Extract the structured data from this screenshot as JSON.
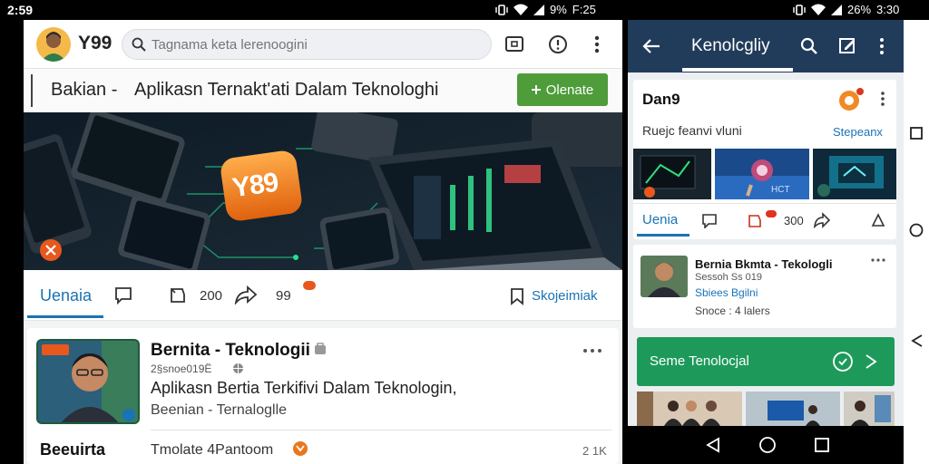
{
  "status_left": {
    "time": "2:59",
    "battery": "9%",
    "clock": "F:25"
  },
  "status_right": {
    "battery": "26%",
    "time": "3:30"
  },
  "left": {
    "app_name": "Y99",
    "search_placeholder": "Tagnama keta lerenoogini",
    "banner": {
      "prefix": "Bakian -",
      "title": "Aplikasn Ternakt'ati Dalam Teknologhi",
      "button": "Olenate"
    },
    "hero_logo": "Y89",
    "actions": {
      "tab": "Uenaia",
      "count": "200",
      "count2": "99",
      "bookmark": "Skojeimiak"
    },
    "post": {
      "badge": "",
      "author": "Bernita - Teknologii",
      "meta": "2§snoe019Ë",
      "title": "Aplikasn Bertia Terkifivi Dalam Teknologin,",
      "subtitle": "Beenian - Ternaloglle",
      "footer_left": "Beeuirta",
      "footer_mid": "Tmolate 4Pantoom",
      "footer_right": "2 1K"
    }
  },
  "right": {
    "title": "Kenolcgliy",
    "card1": {
      "name": "Dan9",
      "desc": "Ruejc feanvi vluni",
      "link": "Stepeanx",
      "tab": "Uenia",
      "count": "300"
    },
    "card2": {
      "author": "Bernia Bkmta - Tekologli",
      "line1": "Sessoh Ss 019",
      "line2": "Sbiees Bgilni",
      "line3": "Snoce : 4 lalers"
    },
    "green": {
      "label": "Seme Tenolocjal"
    }
  },
  "colors": {
    "accent_blue": "#1a73b5",
    "brand_orange": "#f08a24",
    "green_button": "#4e9c3a",
    "green_banner": "#1d9a5a",
    "appbar": "#213c5a"
  }
}
